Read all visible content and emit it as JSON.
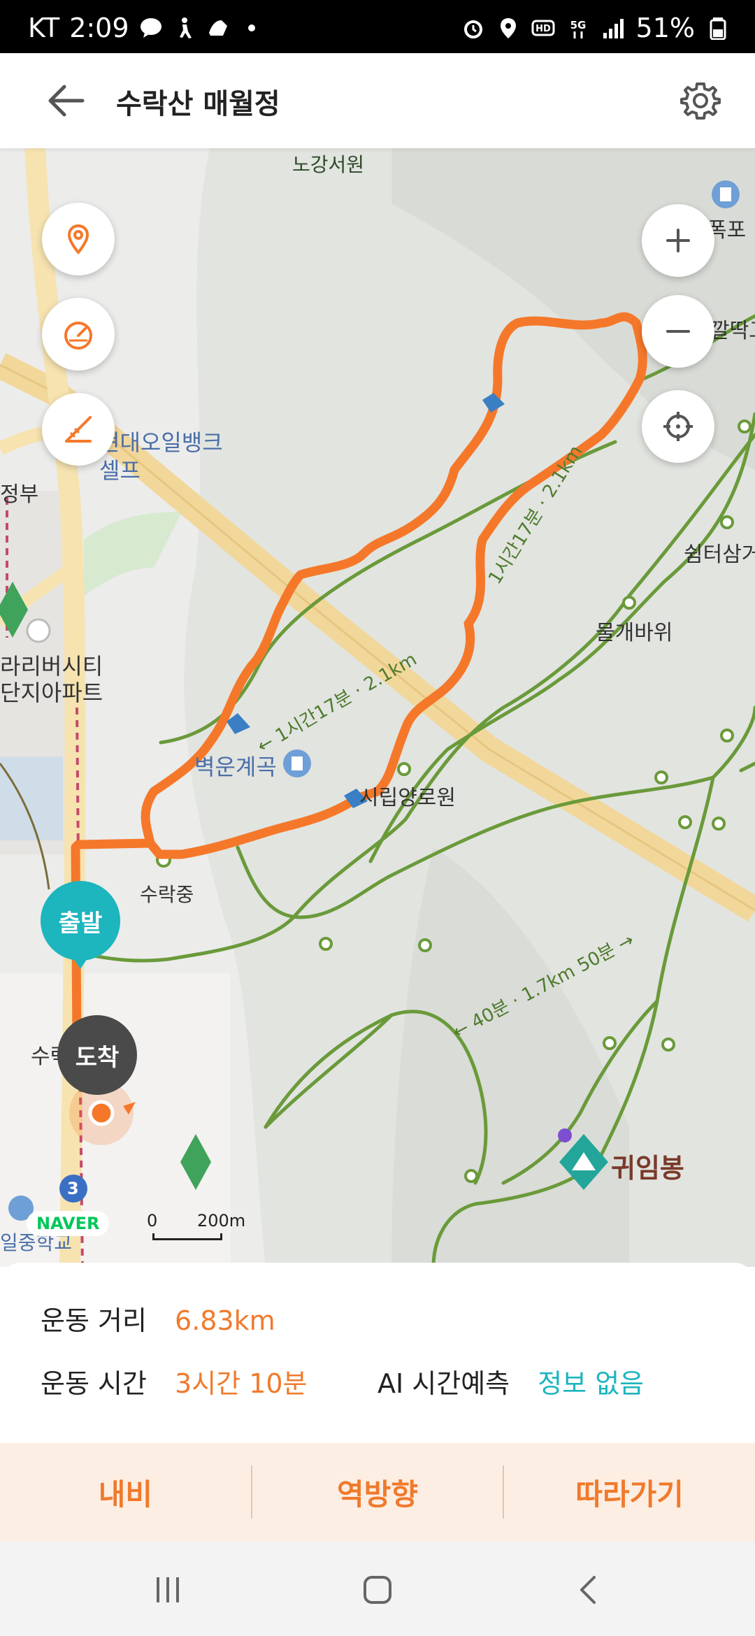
{
  "status": {
    "carrier": "KT",
    "time": "2:09",
    "battery": "51%"
  },
  "header": {
    "title": "수락산 매월정",
    "back_icon": "arrow-left-icon",
    "settings_icon": "gear-icon"
  },
  "map": {
    "labels": {
      "nogang": "노강서원",
      "pokpo": "폭포",
      "kkalttak": "깔딱고",
      "shelter": "쉼터삼거",
      "mulgae": "물개바위",
      "oilbank": "현대오일뱅크",
      "oilbank2": "셀프",
      "apt1": "라리버시티",
      "apt2": "단지아파트",
      "byeoknae": "벽운계곡",
      "nursing": "시립양로원",
      "suranjung": "수락중",
      "suryak": "수락",
      "peak": "귀임봉",
      "trail1": "← 1시간17분 · 2.1km",
      "trail2": "1시간17분 · 2.1km",
      "trail3": "← 40분 · 1.7km 50분 →",
      "school": "일중학교",
      "left_cut": "정부"
    },
    "start_label": "출발",
    "end_label": "도착",
    "naver": "NAVER",
    "scale_zero": "0",
    "scale_value": "200m",
    "route_marker": "3",
    "route_color": "#f5782a",
    "trail_color": "#6a9a3a",
    "controls": [
      "location-pin-icon",
      "speedometer-icon",
      "measure-icon"
    ],
    "zoom": [
      "zoom-in-icon",
      "zoom-out-icon",
      "my-location-icon"
    ]
  },
  "info": {
    "distance_label": "운동 거리",
    "distance_value": "6.83km",
    "time_label": "운동 시간",
    "time_value": "3시간 10분",
    "ai_label": "AI 시간예측",
    "ai_value": "정보 없음"
  },
  "actions": {
    "nav": "내비",
    "reverse": "역방향",
    "follow": "따라가기"
  },
  "colors": {
    "accent_orange": "#f07a2c",
    "teal": "#1db5be",
    "action_bg": "#fdeee3"
  }
}
